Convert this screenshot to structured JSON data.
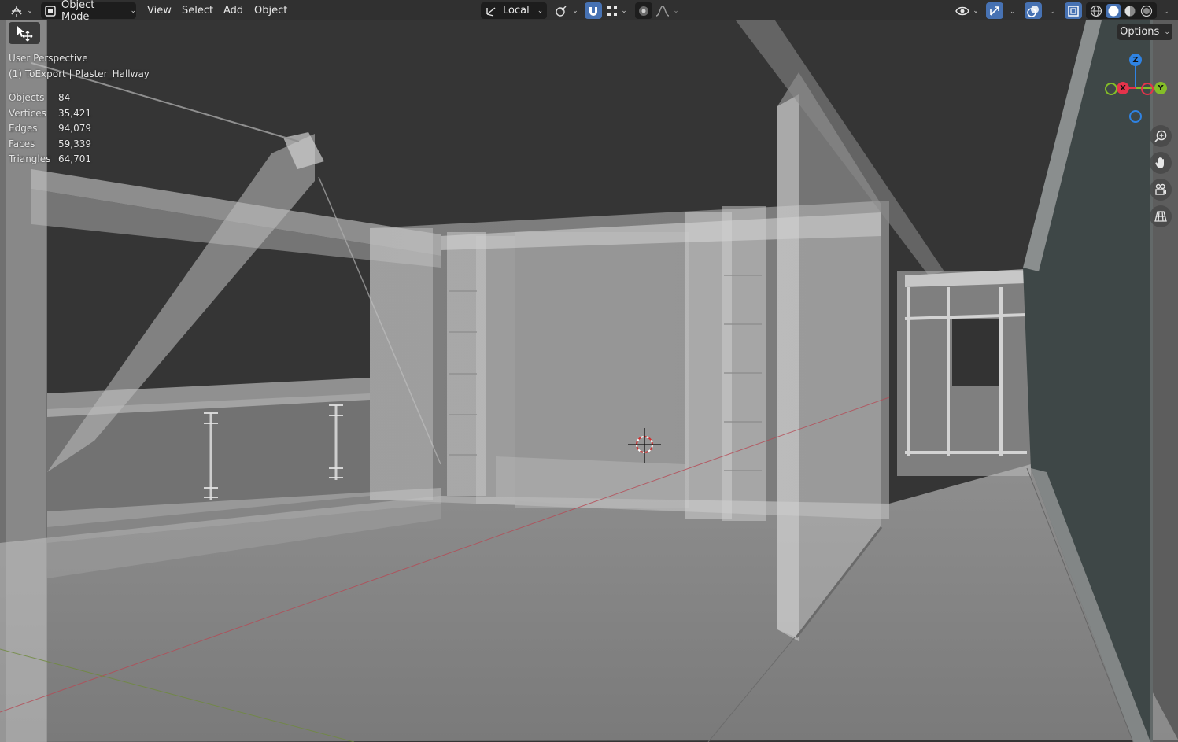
{
  "header": {
    "mode_label": "Object Mode",
    "menu": [
      "View",
      "Select",
      "Add",
      "Object"
    ],
    "transform_orientation": "Local"
  },
  "viewport": {
    "perspective_label": "User Perspective",
    "collection_label": "(1) ToExport | Plaster_Hallway",
    "stats": [
      {
        "label": "Objects",
        "value": "84"
      },
      {
        "label": "Vertices",
        "value": "35,421"
      },
      {
        "label": "Edges",
        "value": "94,079"
      },
      {
        "label": "Faces",
        "value": "59,339"
      },
      {
        "label": "Triangles",
        "value": "64,701"
      }
    ],
    "options_label": "Options"
  },
  "gizmo": {
    "x_label": "X",
    "y_label": "Y",
    "z_label": "Z",
    "x_color": "#e5334b",
    "y_color": "#84bd28",
    "z_color": "#2f83e3"
  },
  "icons": [
    "editor-type-icon",
    "object-mode-icon",
    "local-orientation-icon",
    "pivot-icon",
    "snap-magnet-icon",
    "snap-grid-icon",
    "proportional-edit-icon",
    "falloff-icon",
    "visibility-icon",
    "gizmo-icon",
    "overlay-icon",
    "xray-icon",
    "wireframe-shading-icon",
    "solid-shading-icon",
    "material-shading-icon",
    "rendered-shading-icon",
    "zoom-icon",
    "pan-hand-icon",
    "camera-icon",
    "grid-view-icon",
    "select-move-tool-icon"
  ]
}
